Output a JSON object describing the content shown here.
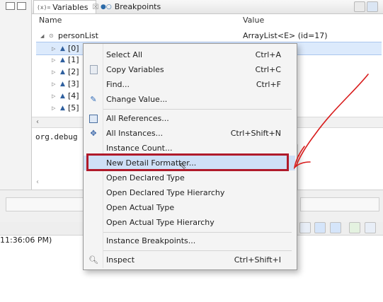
{
  "tabs": {
    "variables": {
      "icon": "(x)=",
      "label": "Variables",
      "close": "☒"
    },
    "breakpoints": {
      "label": "Breakpoints"
    }
  },
  "columns": {
    "name": "Name",
    "value": "Value"
  },
  "tree": {
    "root_name": "personList",
    "root_value": "ArrayList<E>  (id=17)",
    "children": [
      "[0]",
      "[1]",
      "[2]",
      "[3]",
      "[4]",
      "[5]"
    ]
  },
  "detail": {
    "text": "org.debug"
  },
  "status": {
    "time": "11:36:06 PM)"
  },
  "context_menu": {
    "groups": [
      [
        {
          "label": "Select All",
          "shortcut": "Ctrl+A",
          "icon": "none"
        },
        {
          "label": "Copy Variables",
          "shortcut": "Ctrl+C",
          "icon": "copy-icon"
        },
        {
          "label": "Find...",
          "shortcut": "Ctrl+F",
          "icon": "none"
        },
        {
          "label": "Change Value...",
          "shortcut": "",
          "icon": "change-value-icon"
        }
      ],
      [
        {
          "label": "All References...",
          "shortcut": "",
          "icon": "references-icon"
        },
        {
          "label": "All Instances...",
          "shortcut": "Ctrl+Shift+N",
          "icon": "instances-icon"
        },
        {
          "label": "Instance Count...",
          "shortcut": "",
          "icon": "none"
        },
        {
          "label": "New Detail Formatter...",
          "shortcut": "",
          "icon": "none",
          "highlighted": true
        },
        {
          "label": "Open Declared Type",
          "shortcut": "",
          "icon": "none"
        },
        {
          "label": "Open Declared Type Hierarchy",
          "shortcut": "",
          "icon": "none"
        },
        {
          "label": "Open Actual Type",
          "shortcut": "",
          "icon": "none"
        },
        {
          "label": "Open Actual Type Hierarchy",
          "shortcut": "",
          "icon": "none"
        }
      ],
      [
        {
          "label": "Instance Breakpoints...",
          "shortcut": "",
          "icon": "none"
        }
      ],
      [
        {
          "label": "Inspect",
          "shortcut": "Ctrl+Shift+I",
          "icon": "inspect-icon"
        }
      ]
    ]
  },
  "colors": {
    "highlight_box": "#b01a2a",
    "annotation": "#d81b1b",
    "selection": "#dceafc"
  }
}
